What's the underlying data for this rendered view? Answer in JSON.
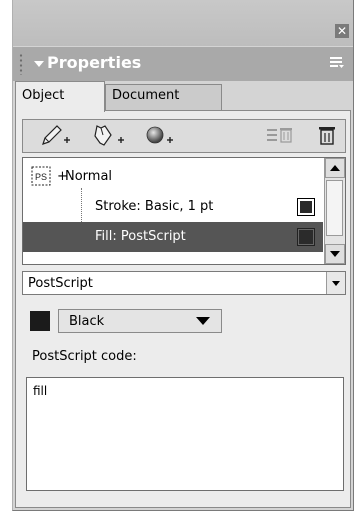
{
  "panel": {
    "title": "Properties",
    "close_glyph": "✕"
  },
  "tabs": [
    {
      "label": "Object",
      "active": true
    },
    {
      "label": "Document",
      "active": false
    }
  ],
  "toolbar": {
    "buttons": [
      {
        "icon": "pencil-add-icon"
      },
      {
        "icon": "pen-tool-add-icon"
      },
      {
        "icon": "effect-add-icon"
      },
      {
        "icon": "list-delete-icon"
      },
      {
        "icon": "trash-icon"
      }
    ]
  },
  "attributes": {
    "items": [
      {
        "label": "Normal",
        "prefix": "+",
        "icon": "postscript-object-icon"
      },
      {
        "label": "Stroke: Basic, 1 pt",
        "swatch": "#2a2a2a"
      },
      {
        "label": "Fill: PostScript",
        "swatch": "#2b2b2b",
        "selected": true
      }
    ]
  },
  "fill_type": {
    "value": "PostScript"
  },
  "color": {
    "swatch": "#1b1b1b",
    "value": "Black"
  },
  "code": {
    "label": "PostScript code:",
    "value": "fill"
  }
}
